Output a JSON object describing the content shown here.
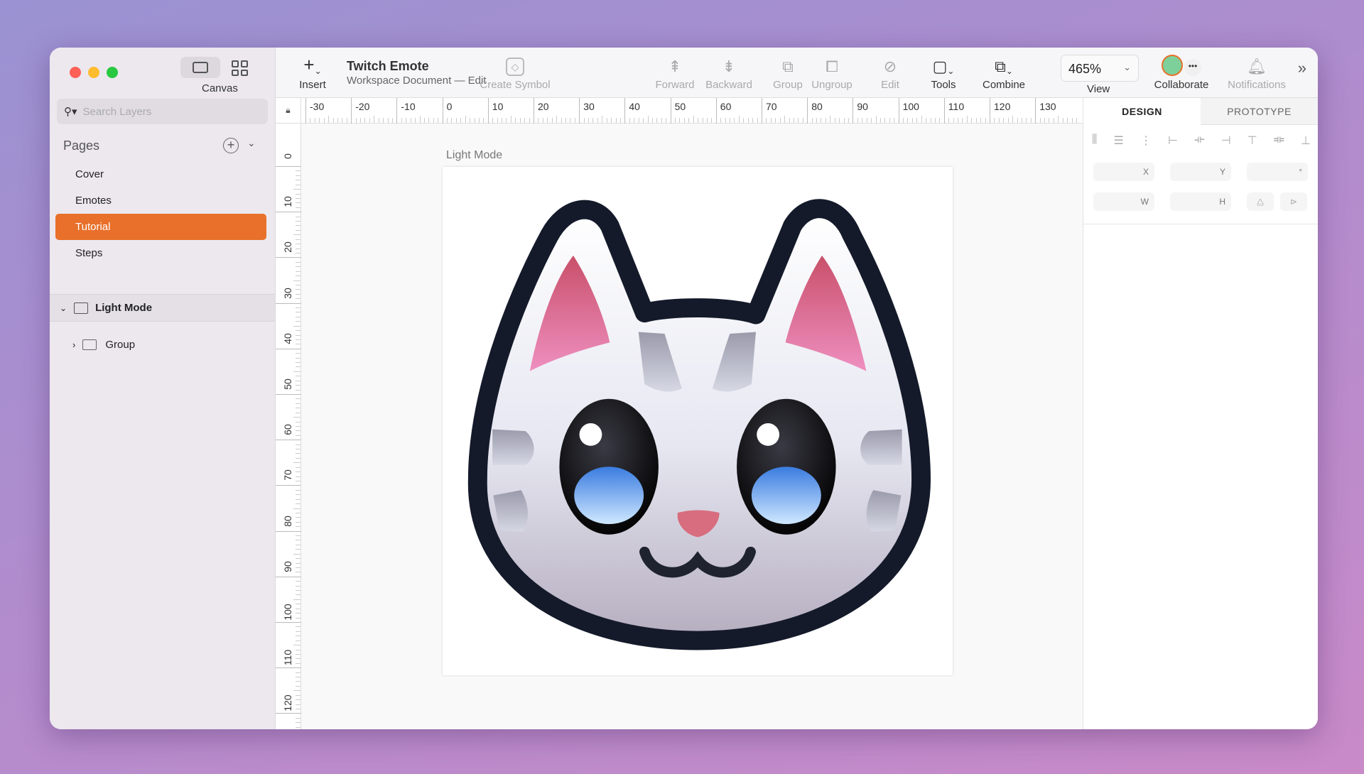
{
  "window": {
    "title": "Twitch Emote",
    "subtitle": "Workspace Document — Edit"
  },
  "sidebar": {
    "canvas_label": "Canvas",
    "search_placeholder": "Search Layers",
    "pages_title": "Pages",
    "pages": [
      {
        "label": "Cover"
      },
      {
        "label": "Emotes"
      },
      {
        "label": "Tutorial",
        "selected": true
      },
      {
        "label": "Steps"
      }
    ],
    "layers": [
      {
        "label": "Light Mode",
        "icon": "artboard-icon",
        "expanded": true
      },
      {
        "label": "Group",
        "icon": "folder-icon",
        "expanded": false
      }
    ]
  },
  "toolbar": {
    "insert": "Insert",
    "create_symbol": "Create Symbol",
    "forward": "Forward",
    "backward": "Backward",
    "group": "Group",
    "ungroup": "Ungroup",
    "edit": "Edit",
    "tools": "Tools",
    "combine": "Combine",
    "zoom": "465%",
    "view": "View",
    "collaborate": "Collaborate",
    "notifications": "Notifications"
  },
  "rulers": {
    "horizontal": [
      "-30",
      "-20",
      "-10",
      "0",
      "10",
      "20",
      "30",
      "40",
      "50",
      "60",
      "70",
      "80",
      "90",
      "100",
      "110",
      "120",
      "130"
    ],
    "vertical": [
      "0",
      "10",
      "20",
      "30",
      "40",
      "50",
      "60",
      "70",
      "80",
      "90",
      "100",
      "110",
      "120"
    ]
  },
  "canvas": {
    "artboard_label": "Light Mode"
  },
  "inspector": {
    "tabs": [
      "DESIGN",
      "PROTOTYPE"
    ],
    "x_label": "X",
    "y_label": "Y",
    "rot_label": "°",
    "w_label": "W",
    "h_label": "H"
  },
  "colors": {
    "accent": "#e8702a",
    "outline": "#141a2a",
    "ear": "#d95a78",
    "eye_blue": "#4a90e0"
  }
}
